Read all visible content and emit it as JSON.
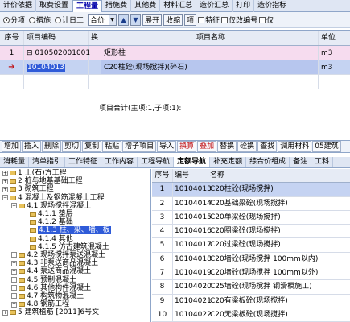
{
  "top_tabs": [
    "计价依据",
    "取费设置",
    "工程量",
    "措施费",
    "其他费",
    "材料汇总",
    "造价汇总",
    "打印",
    "造价指标"
  ],
  "active_tab_index": 2,
  "options": {
    "radio_fenxiang": "分项",
    "radio_cuoshi": "措施",
    "radio_jiri": "计日工",
    "select_value": "合价",
    "select_arrow": "▼",
    "up_arrow": "▲",
    "down_arrow": "▼",
    "expand": "展开",
    "collapse": "收缩",
    "item_label": "项",
    "check_te": "特征",
    "check_only_code": "仅改编号",
    "check_code": "仅"
  },
  "table1": {
    "headers": {
      "seq": "序号",
      "code": "项目编码",
      "huan": "换",
      "name": "项目名称",
      "unit": "单位"
    },
    "rows": [
      {
        "seq": "1",
        "code": "010502001001",
        "huan": "",
        "name": "矩形柱",
        "unit": "m3"
      },
      {
        "seq": "",
        "code": "10104013",
        "huan": "",
        "name": "C20柱砼(现场搅拌)(碎石)",
        "unit": "m3"
      }
    ],
    "total": "项目合计(主项:1,子项:1):",
    "selected_marker": "➔"
  },
  "toolbar": [
    "增加",
    "插入",
    "删除",
    "剪切",
    "复制",
    "粘贴",
    "增子项目",
    "导入",
    "换算",
    "叠加",
    "替换",
    "砼换",
    "查找",
    "调用材料",
    "05建筑"
  ],
  "toolbar_red": [
    "换算",
    "叠加"
  ],
  "bottom_tabs": [
    "消耗量",
    "清单指引",
    "工作特征",
    "工作内容",
    "工程导航",
    "定额导航",
    "补充定额",
    "综合价组成",
    "备注",
    "工料"
  ],
  "bottom_active_index": 5,
  "tree": [
    {
      "label": "1 土(石)方工程",
      "indent": 0,
      "toggle": "+"
    },
    {
      "label": "2 桩与地基基础工程",
      "indent": 0,
      "toggle": "+"
    },
    {
      "label": "3 砌筑工程",
      "indent": 0,
      "toggle": "+"
    },
    {
      "label": "4 混凝土及钢筋混凝土工程",
      "indent": 0,
      "toggle": "−"
    },
    {
      "label": "4.1 现场搅拌混凝土",
      "indent": 1,
      "toggle": "−"
    },
    {
      "label": "4.1.1 垫层",
      "indent": 2,
      "toggle": ""
    },
    {
      "label": "4.1.2 基础",
      "indent": 2,
      "toggle": ""
    },
    {
      "label": "4.1.3 柱、梁、墙、板",
      "indent": 2,
      "toggle": "",
      "selected": true
    },
    {
      "label": "4.1.4 其他",
      "indent": 2,
      "toggle": ""
    },
    {
      "label": "4.1.5 仿古建筑混凝土",
      "indent": 2,
      "toggle": ""
    },
    {
      "label": "4.2 现场搅拌泵送混凝土",
      "indent": 1,
      "toggle": "+"
    },
    {
      "label": "4.3 非泵送商品混凝土",
      "indent": 1,
      "toggle": "+"
    },
    {
      "label": "4.4 泵送商品混凝土",
      "indent": 1,
      "toggle": "+"
    },
    {
      "label": "4.5 预制混凝土",
      "indent": 1,
      "toggle": "+"
    },
    {
      "label": "4.6 其他构件混凝土",
      "indent": 1,
      "toggle": "+"
    },
    {
      "label": "4.7 构筑物混凝土",
      "indent": 1,
      "toggle": "+"
    },
    {
      "label": "4.8 钢筋工程",
      "indent": 1,
      "toggle": "+"
    },
    {
      "label": "5 建筑植筋 [2011]6号文",
      "indent": 0,
      "toggle": "+"
    }
  ],
  "table2": {
    "headers": {
      "seq": "序号",
      "code": "编号",
      "name": "名称"
    },
    "rows": [
      {
        "seq": "1",
        "code": "10104013",
        "name": "C20柱砼(现场搅拌)"
      },
      {
        "seq": "2",
        "code": "10104014",
        "name": "C20基础梁砼(现场搅拌)"
      },
      {
        "seq": "3",
        "code": "10104015",
        "name": "C20单梁砼(现场搅拌)"
      },
      {
        "seq": "4",
        "code": "10104016",
        "name": "C20圈梁砼(现场搅拌)"
      },
      {
        "seq": "5",
        "code": "10104017",
        "name": "C20过梁砼(现场搅拌)"
      },
      {
        "seq": "6",
        "code": "10104018",
        "name": "C20墙砼(现场搅拌 100mm以内)"
      },
      {
        "seq": "7",
        "code": "10104019",
        "name": "C20墙砼(现场搅拌 100mm以外)"
      },
      {
        "seq": "8",
        "code": "10104020",
        "name": "C25墙砼(现场搅拌 钢滑模施工)"
      },
      {
        "seq": "9",
        "code": "10104021",
        "name": "C20有梁板砼(现场搅拌)"
      },
      {
        "seq": "10",
        "code": "10104022",
        "name": "C20无梁板砼(现场搅拌)"
      },
      {
        "seq": "11",
        "code": "10104023",
        "name": "C20平板砼(现场搅拌)"
      }
    ]
  },
  "colors": {
    "accent": "#2f5bd8",
    "row_pink": "#f6dcef",
    "row_blue": "#c5d3f2",
    "red_text": "#c0161a"
  }
}
